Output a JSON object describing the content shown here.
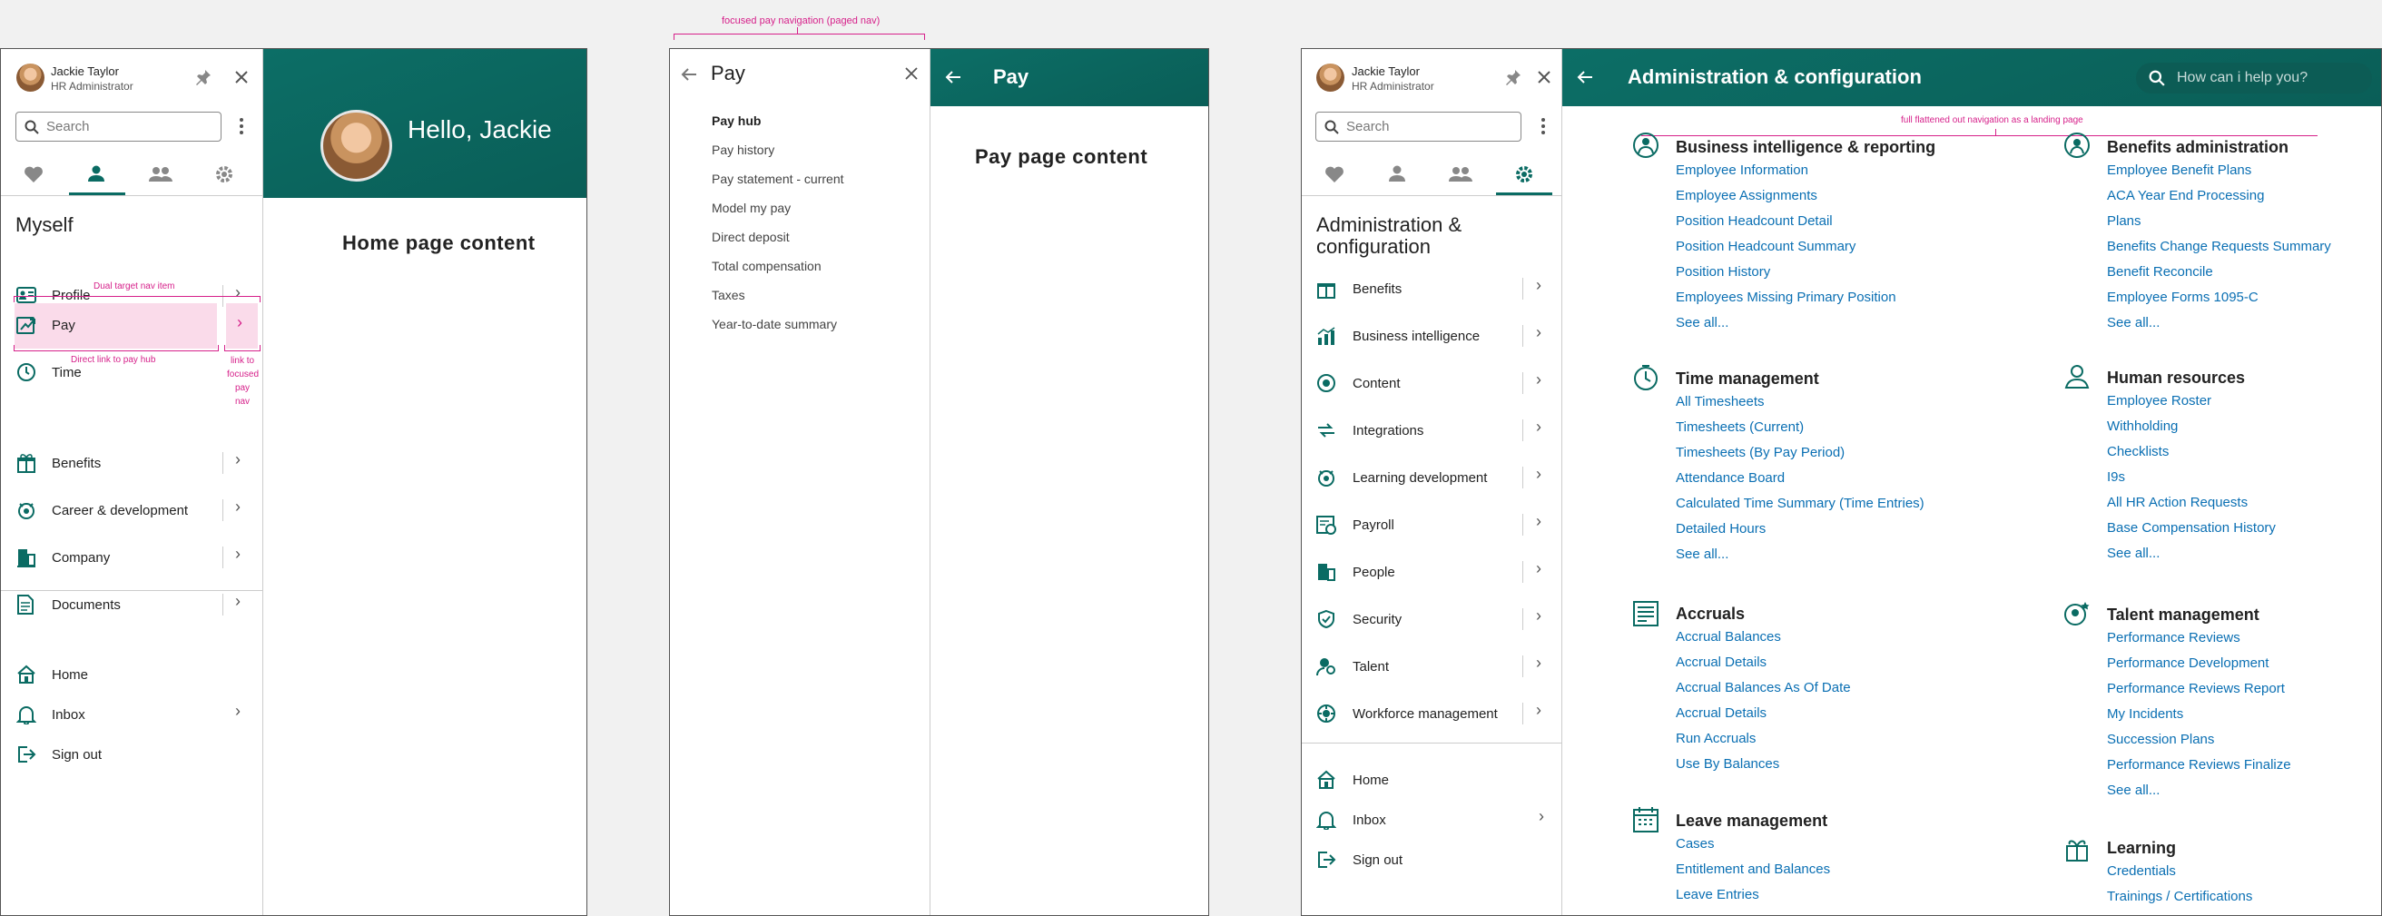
{
  "annotations": {
    "focused_pay_nav": "focused  pay navigation (paged nav)",
    "dual_target": "Dual target nav item",
    "direct_link": "Direct link to pay hub",
    "link_focused_1": "link to",
    "link_focused_2": "focused",
    "link_focused_3": "pay nav",
    "flattened": "full flattened out navigation as a landing page"
  },
  "panel1": {
    "user_name": "Jackie Taylor",
    "user_role": "HR Administrator",
    "search_placeholder": "Search",
    "section_title": "Myself",
    "items": [
      {
        "label": "Profile"
      },
      {
        "label": "Pay"
      },
      {
        "label": "Time"
      },
      {
        "label": "Benefits"
      },
      {
        "label": "Career & development"
      },
      {
        "label": "Company"
      },
      {
        "label": "Documents"
      }
    ],
    "footer": [
      {
        "label": "Home"
      },
      {
        "label": "Inbox"
      },
      {
        "label": "Sign out"
      }
    ],
    "greeting": "Hello, Jackie",
    "content": "Home page content"
  },
  "panel2": {
    "title": "Pay",
    "items": [
      "Pay hub",
      "Pay history",
      "Pay statement - current",
      "Model my pay",
      "Direct deposit",
      "Total compensation",
      "Taxes",
      "Year-to-date summary"
    ],
    "header_title": "Pay",
    "content": "Pay page content"
  },
  "panel3": {
    "user_name": "Jackie Taylor",
    "user_role": "HR Administrator",
    "search_placeholder": "Search",
    "section_title": "Administration & configuration",
    "items": [
      {
        "label": "Benefits"
      },
      {
        "label": "Business intelligence"
      },
      {
        "label": "Content"
      },
      {
        "label": "Integrations"
      },
      {
        "label": "Learning development"
      },
      {
        "label": "Payroll"
      },
      {
        "label": "People"
      },
      {
        "label": "Security"
      },
      {
        "label": "Talent"
      },
      {
        "label": "Workforce management"
      }
    ],
    "footer": [
      {
        "label": "Home"
      },
      {
        "label": "Inbox"
      },
      {
        "label": "Sign out"
      }
    ],
    "header_title": "Administration & configuration",
    "help_placeholder": "How can i help you?",
    "sections": {
      "bi": {
        "title": "Business intelligence & reporting",
        "links": [
          "Employee Information",
          "Employee Assignments",
          "Position Headcount Detail",
          "Position Headcount Summary",
          "Position History",
          "Employees Missing Primary Position",
          "See all..."
        ]
      },
      "time": {
        "title": "Time management",
        "links": [
          "All Timesheets",
          "Timesheets (Current)",
          "Timesheets (By Pay Period)",
          "Attendance Board",
          "Calculated Time Summary (Time Entries)",
          "Detailed Hours",
          "See all..."
        ]
      },
      "accruals": {
        "title": "Accruals",
        "links": [
          "Accrual Balances",
          "Accrual Details",
          "Accrual Balances As Of Date",
          "Accrual Details",
          "Run Accruals",
          "Use By Balances"
        ]
      },
      "leave": {
        "title": "Leave management",
        "links": [
          "Cases",
          "Entitlement and Balances",
          "Leave Entries"
        ]
      },
      "benefits": {
        "title": "Benefits administration",
        "links": [
          "Employee Benefit Plans",
          "ACA Year End Processing",
          "Plans",
          "Benefits Change Requests Summary",
          "Benefit Reconcile",
          "Employee Forms 1095-C",
          "See all..."
        ]
      },
      "hr": {
        "title": "Human resources",
        "links": [
          "Employee Roster",
          "Withholding",
          "Checklists",
          "I9s",
          "All HR Action Requests",
          "Base Compensation History",
          "See all..."
        ]
      },
      "talent": {
        "title": "Talent management",
        "links": [
          "Performance Reviews",
          "Performance Development",
          "Performance Reviews Report",
          "My Incidents",
          "Succession Plans",
          "Performance Reviews Finalize",
          "See all..."
        ]
      },
      "learning": {
        "title": "Learning",
        "links": [
          "Credentials",
          "Trainings / Certifications"
        ]
      }
    }
  },
  "colors": {
    "teal": "#0a6b63",
    "link": "#0a6fb3",
    "annotation": "#d6208a",
    "highlight": "#fadbea"
  }
}
